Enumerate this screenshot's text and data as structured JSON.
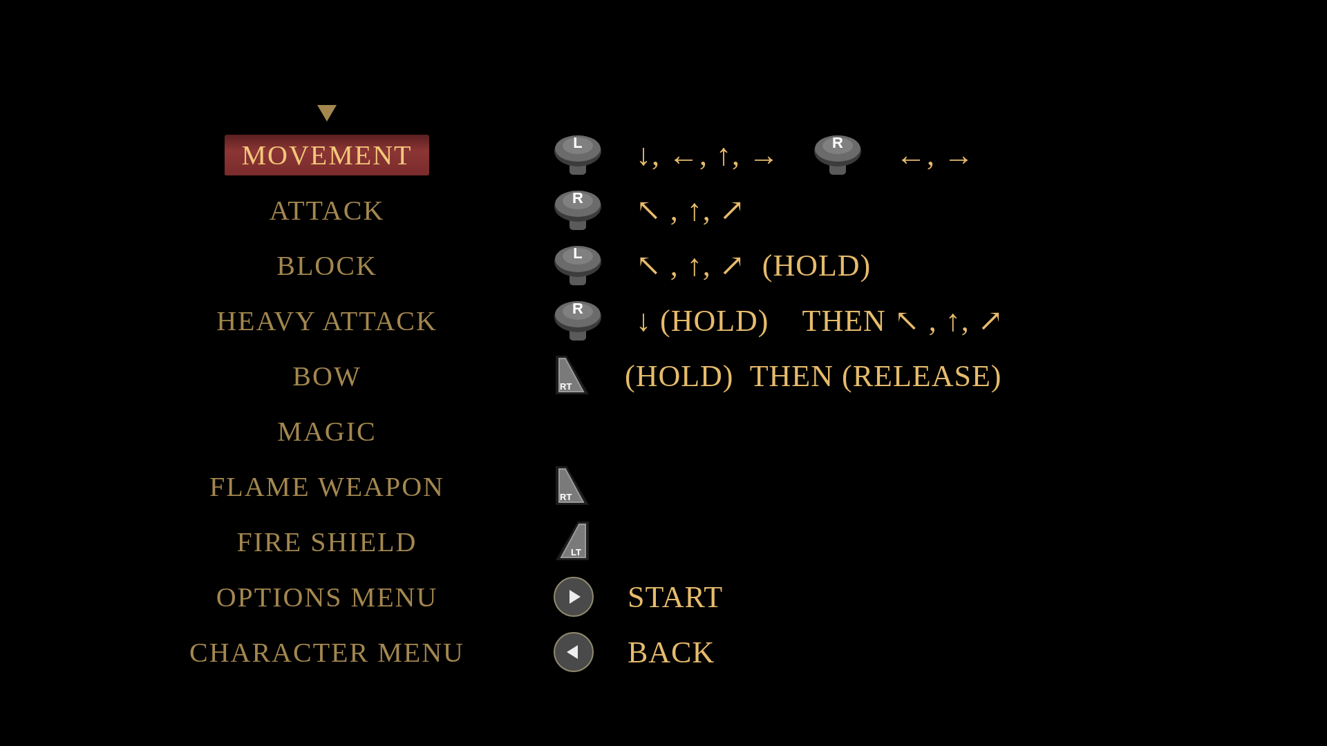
{
  "rows": [
    {
      "label": "MOVEMENT",
      "selected": true,
      "binding": [
        {
          "kind": "stick",
          "text": "L"
        },
        {
          "kind": "text",
          "text": "↓, ←, ↑, →"
        },
        {
          "kind": "stick",
          "text": "R"
        },
        {
          "kind": "text",
          "text": "←, →"
        }
      ]
    },
    {
      "label": "ATTACK",
      "selected": false,
      "binding": [
        {
          "kind": "stick",
          "text": "R"
        },
        {
          "kind": "text",
          "text": "↖ , ↑, ↗"
        }
      ]
    },
    {
      "label": "BLOCK",
      "selected": false,
      "binding": [
        {
          "kind": "stick",
          "text": "L"
        },
        {
          "kind": "text",
          "text": "↖ , ↑, ↗  (HOLD)"
        }
      ]
    },
    {
      "label": "HEAVY ATTACK",
      "selected": false,
      "binding": [
        {
          "kind": "stick",
          "text": "R"
        },
        {
          "kind": "text",
          "text": "↓ (HOLD)"
        },
        {
          "kind": "text",
          "text": "THEN ↖ , ↑, ↗"
        }
      ]
    },
    {
      "label": "BOW",
      "selected": false,
      "binding": [
        {
          "kind": "trigger-right",
          "text": "RT"
        },
        {
          "kind": "text",
          "text": "(HOLD)  THEN (RELEASE)"
        }
      ]
    },
    {
      "label": "MAGIC",
      "selected": false,
      "binding": []
    },
    {
      "label": "FLAME WEAPON",
      "selected": false,
      "binding": [
        {
          "kind": "trigger-right",
          "text": "RT"
        }
      ]
    },
    {
      "label": "FIRE SHIELD",
      "selected": false,
      "binding": [
        {
          "kind": "trigger-left",
          "text": "LT"
        }
      ]
    },
    {
      "label": "OPTIONS MENU",
      "selected": false,
      "binding": [
        {
          "kind": "start"
        },
        {
          "kind": "text",
          "text": "START"
        }
      ]
    },
    {
      "label": "CHARACTER MENU",
      "selected": false,
      "binding": [
        {
          "kind": "back"
        },
        {
          "kind": "text",
          "text": "BACK"
        }
      ]
    }
  ]
}
